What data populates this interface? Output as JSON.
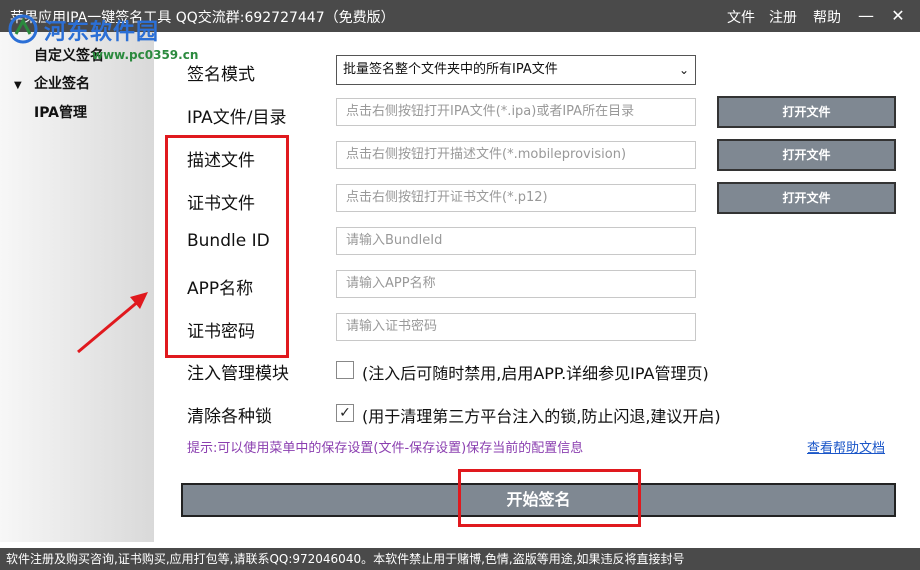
{
  "titlebar": {
    "title": "苹果应用IPA一键签名工具 QQ交流群:692727447（免费版）",
    "menu": [
      "文件",
      "注册",
      "帮助"
    ],
    "minimize": "—",
    "close": "✕"
  },
  "watermark": {
    "name": "河东软件园",
    "url": "www.pc0359.cn"
  },
  "sidebar": {
    "items": [
      {
        "label": "自定义签名"
      },
      {
        "label": "企业签名"
      },
      {
        "label": "IPA管理"
      }
    ]
  },
  "form": {
    "sign_mode": {
      "label": "签名模式",
      "selected": "批量签名整个文件夹中的所有IPA文件"
    },
    "ipa": {
      "label": "IPA文件/目录",
      "placeholder": "点击右侧按钮打开IPA文件(*.ipa)或者IPA所在目录",
      "button": "打开文件"
    },
    "profile": {
      "label": "描述文件",
      "placeholder": "点击右侧按钮打开描述文件(*.mobileprovision)",
      "button": "打开文件"
    },
    "cert": {
      "label": "证书文件",
      "placeholder": "点击右侧按钮打开证书文件(*.p12)",
      "button": "打开文件"
    },
    "bundle_id": {
      "label": "Bundle ID",
      "placeholder": "请输入BundleId"
    },
    "app_name": {
      "label": "APP名称",
      "placeholder": "请输入APP名称"
    },
    "cert_password": {
      "label": "证书密码",
      "placeholder": "请输入证书密码"
    },
    "inject_module": {
      "label": "注入管理模块",
      "checked": false,
      "description": "(注入后可随时禁用,启用APP.详细参见IPA管理页)"
    },
    "clear_locks": {
      "label": "清除各种锁",
      "checked": true,
      "check_mark": "✓",
      "description": "(用于清理第三方平台注入的锁,防止闪退,建议开启)"
    }
  },
  "tip": "提示:可以使用菜单中的保存设置(文件-保存设置)保存当前的配置信息",
  "help_link": "查看帮助文档",
  "start_button": "开始签名",
  "status_text": "软件注册及购买咨询,证书购买,应用打包等,请联系QQ:972046040。本软件禁止用于赌博,色情,盗版等用途,如果违反将直接封号",
  "colors": {
    "titlebar": "#4a4a4a",
    "button": "#7f8892",
    "highlight": "#e0191e",
    "tip": "#8b3fb0",
    "link": "#1a56c8"
  }
}
